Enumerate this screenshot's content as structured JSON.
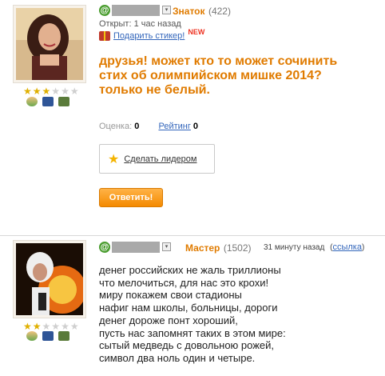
{
  "question": {
    "user_rank": "Знаток",
    "user_rank_count": "(422)",
    "opened_label": "Открыт: 1 час назад",
    "gift_link": "Подарить стикер!",
    "new_badge": "NEW",
    "text": "друзья! может кто то может сочинить стих об олимпийском мишке 2014? только не белый.",
    "rating_label": "Оценка:",
    "rating_value": "0",
    "rank_link": "Рейтинг",
    "rank_value": "0",
    "make_leader": "Сделать лидером",
    "answer_button": "Ответить!",
    "stars": 3
  },
  "answer": {
    "user_rank": "Мастер",
    "user_rank_count": "(1502)",
    "time": "31 минуту назад",
    "link_open": "(",
    "link_label": "ссылка",
    "link_close": ")",
    "text": "денег российских не жаль триллионы\nчто мелочиться, для нас это крохи!\nмиру покажем свои стадионы\nнафиг нам школы, больницы, дороги\nденег дороже понт хороший,\nпусть нас запомнят таких в этом мире:\nсытый медведь с довольною рожей,\nсимвол два ноль один и четыре.",
    "stars": 2
  },
  "icons": {
    "at": "@",
    "dropdown": "▾",
    "star": "★"
  },
  "colors": {
    "accent": "#e07b00",
    "link": "#3366bb",
    "star": "#e0b000"
  }
}
